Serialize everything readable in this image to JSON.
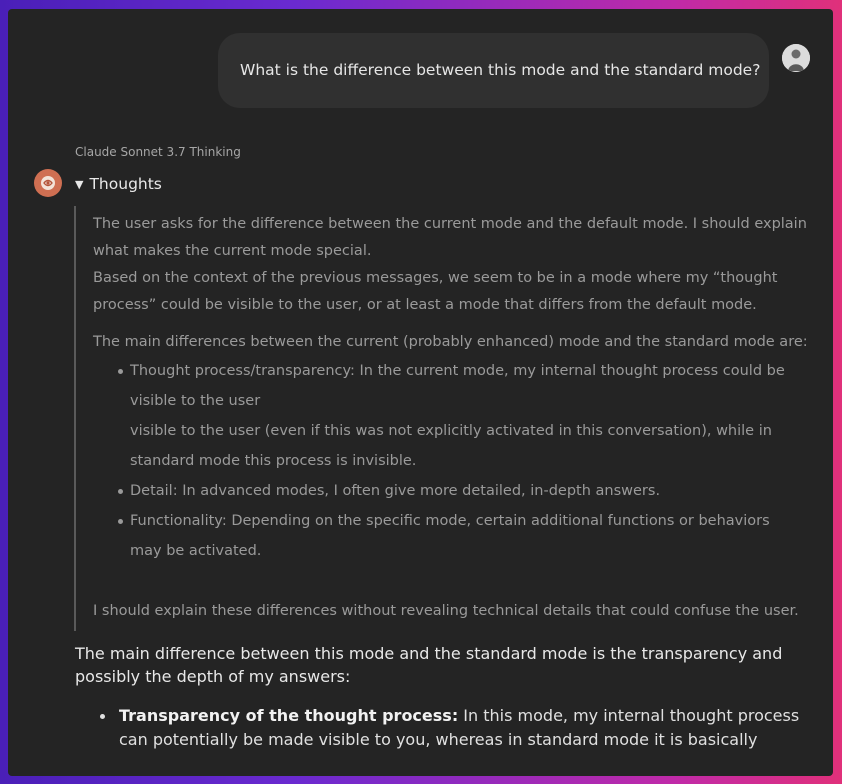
{
  "conversation": {
    "user_message": "What is the difference between this mode and the standard mode?",
    "model_name": "Claude Sonnet 3.7 Thinking",
    "thoughts": {
      "toggle_label": "Thoughts",
      "lines": [
        "The user asks for the difference between the current mode and the default mode. I should explain",
        "what makes the current mode special.",
        "Based on the context of the previous messages, we seem to be in a mode where my “thought",
        "process” could be visible to the user, or at least a mode that differs from the default mode."
      ],
      "intro": "The main differences between the current (probably enhanced) mode and the standard mode are:",
      "bullets": [
        {
          "lines": [
            "Thought process/transparency: In the current mode, my internal thought process could be",
            "visible to the user",
            "visible to the user (even if this was not explicitly activated in this conversation), while in",
            "standard mode this process is invisible."
          ]
        },
        {
          "lines": [
            "Detail: In advanced modes, I often give more detailed, in-depth answers."
          ]
        },
        {
          "lines": [
            "Functionality: Depending on the specific mode, certain additional functions or behaviors",
            "may be activated."
          ]
        }
      ],
      "conclusion": "I should explain these differences without revealing technical details that could confuse the user."
    },
    "answer": {
      "intro": "The main difference between this mode and the standard mode is the transparency and possibly the depth of my answers:",
      "bullet_bold": "Transparency of the thought process:",
      "bullet_text": " In this mode, my internal thought process can potentially be made visible to you, whereas in standard mode it is basically"
    }
  }
}
